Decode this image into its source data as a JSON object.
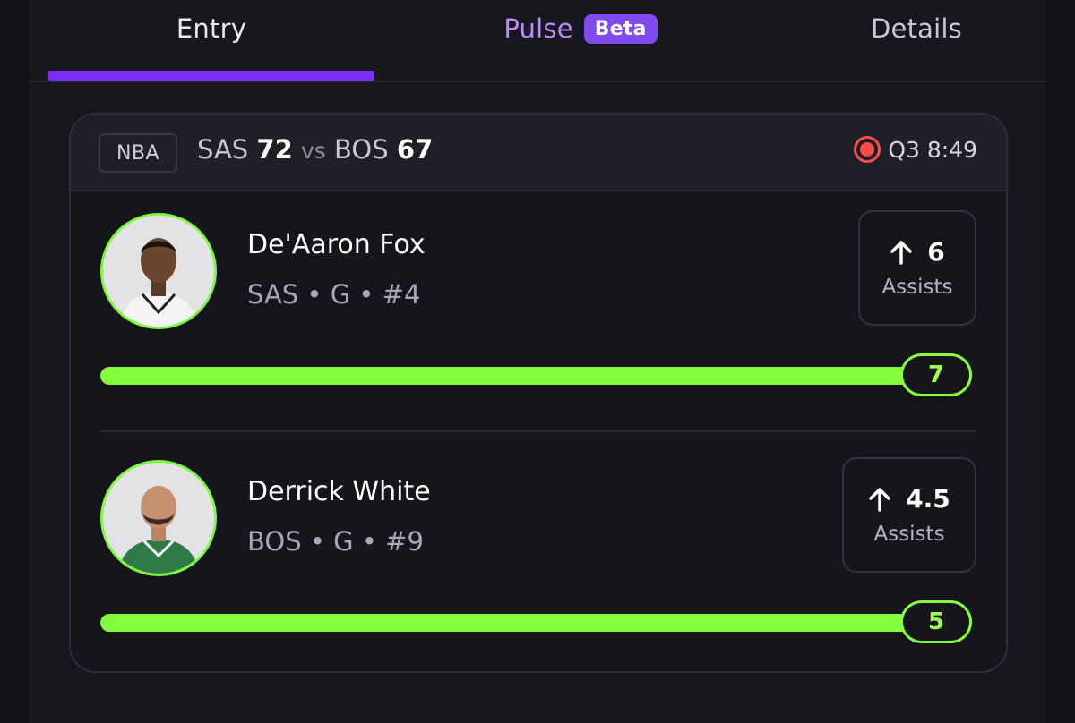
{
  "tabs": {
    "entry": "Entry",
    "pulse": "Pulse",
    "pulse_badge": "Beta",
    "details": "Details"
  },
  "game": {
    "league": "NBA",
    "team1": "SAS",
    "score1": "72",
    "vs": "vs",
    "team2": "BOS",
    "score2": "67",
    "status": "Q3 8:49"
  },
  "players": [
    {
      "name": "De'Aaron Fox",
      "meta": "SAS • G • #4",
      "direction_icon": "arrow-up-icon",
      "line": "6",
      "stat": "Assists",
      "current": "7",
      "progress": 1.0,
      "jersey_color": "#f3f3f3"
    },
    {
      "name": "Derrick White",
      "meta": "BOS • G • #9",
      "direction_icon": "arrow-up-icon",
      "line": "4.5",
      "stat": "Assists",
      "current": "5",
      "progress": 1.0,
      "jersey_color": "#2f7a46"
    }
  ],
  "colors": {
    "accent": "#7b2cf6",
    "progress": "#84ff3d",
    "live": "#ff4b4b"
  }
}
